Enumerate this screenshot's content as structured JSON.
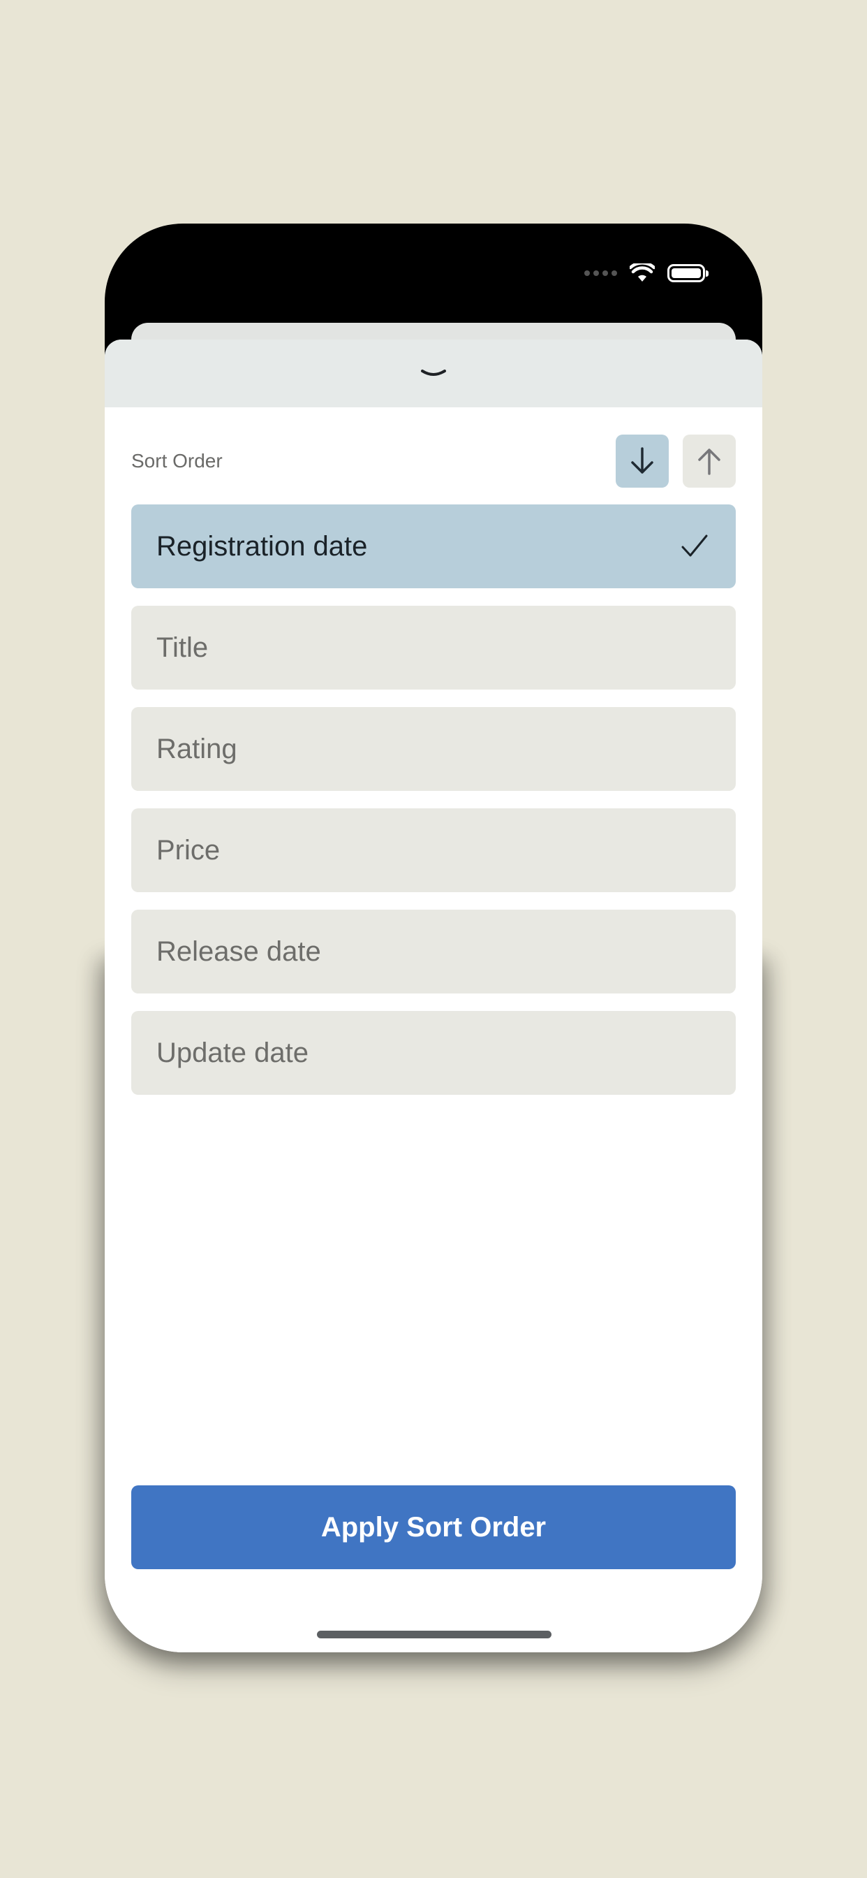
{
  "sheet": {
    "grabber_icon": "chevron-down-icon",
    "sort_title": "Sort Order",
    "direction": {
      "descending_icon": "arrow-down-icon",
      "ascending_icon": "arrow-up-icon",
      "selected": "descending"
    },
    "options": [
      {
        "label": "Registration date",
        "selected": true
      },
      {
        "label": "Title",
        "selected": false
      },
      {
        "label": "Rating",
        "selected": false
      },
      {
        "label": "Price",
        "selected": false
      },
      {
        "label": "Release date",
        "selected": false
      },
      {
        "label": "Update date",
        "selected": false
      }
    ],
    "apply_label": "Apply Sort Order"
  },
  "colors": {
    "background": "#e8e5d5",
    "selected": "#b7ceda",
    "option": "#e8e8e2",
    "apply": "#4075c3"
  }
}
